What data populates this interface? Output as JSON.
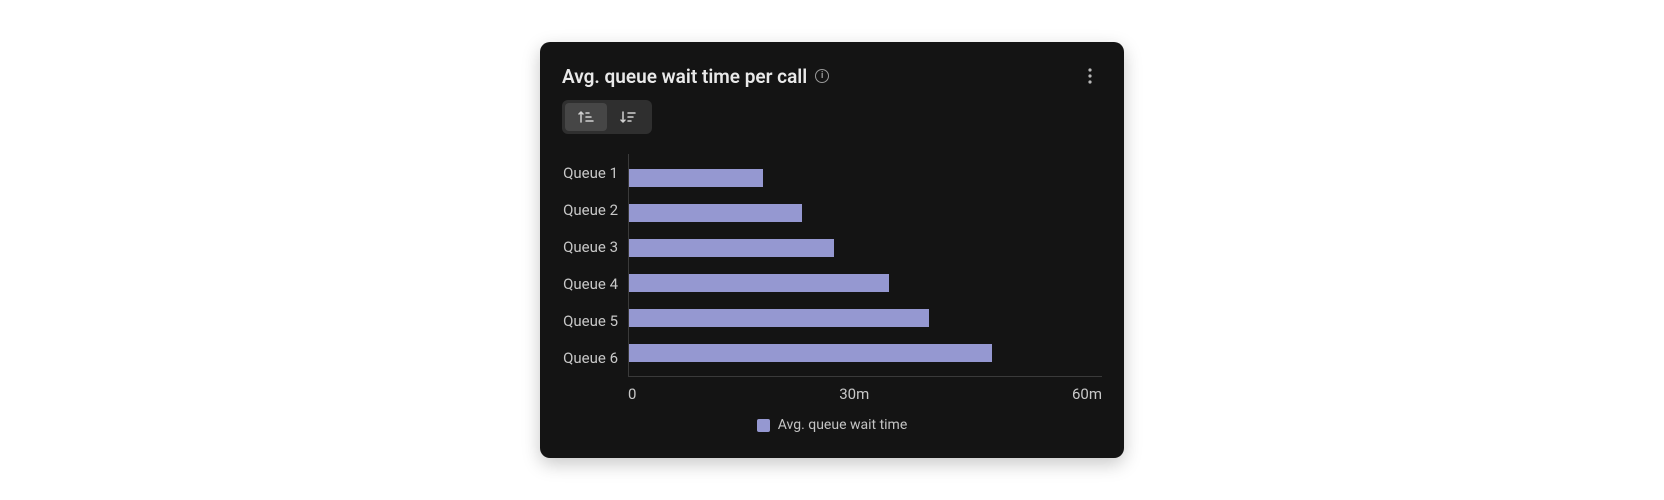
{
  "card": {
    "title": "Avg. queue wait time per call",
    "legend_label": "Avg. queue wait time"
  },
  "x_ticks": [
    "0",
    "30m",
    "60m"
  ],
  "chart_data": {
    "type": "bar",
    "orientation": "horizontal",
    "categories": [
      "Queue 1",
      "Queue 2",
      "Queue 3",
      "Queue 4",
      "Queue 5",
      "Queue 6"
    ],
    "values": [
      17,
      22,
      26,
      33,
      38,
      46
    ],
    "series": [
      {
        "name": "Avg. queue wait time",
        "values": [
          17,
          22,
          26,
          33,
          38,
          46
        ],
        "color": "#9598d1"
      }
    ],
    "title": "Avg. queue wait time per call",
    "xlabel": "",
    "ylabel": "",
    "xlim": [
      0,
      60
    ],
    "x_unit": "minutes",
    "grid": false,
    "legend_position": "bottom"
  }
}
